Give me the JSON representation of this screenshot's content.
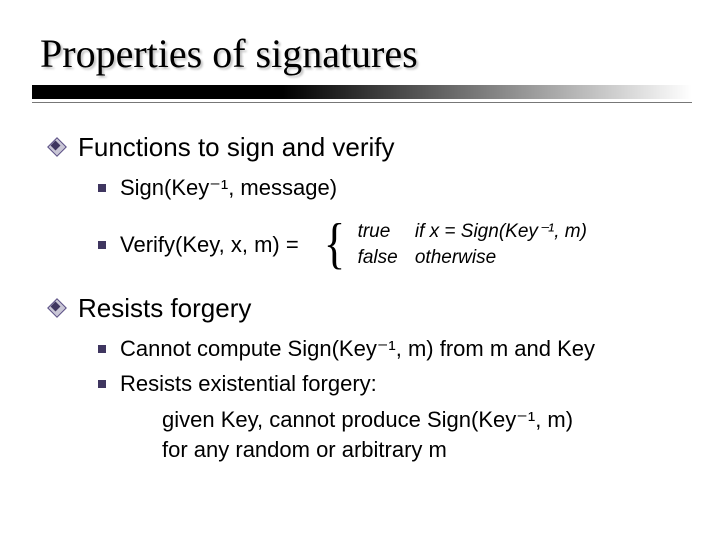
{
  "title": "Properties of signatures",
  "functions": {
    "heading": "Functions to sign and verify",
    "sign": "Sign(Key⁻¹, message)",
    "verify_lhs": "Verify(Key, x, m) =",
    "cases": {
      "true_label": "true",
      "true_cond": "if x = Sign(Key⁻¹, m)",
      "false_label": "false",
      "false_cond": "otherwise"
    }
  },
  "resists": {
    "heading": "Resists forgery",
    "cannot_compute": "Cannot compute Sign(Key⁻¹, m) from m and Key",
    "existential_heading": "Resists existential forgery:",
    "existential_line1": "given Key, cannot produce Sign(Key⁻¹, m)",
    "existential_line2": "for any random or arbitrary m"
  }
}
